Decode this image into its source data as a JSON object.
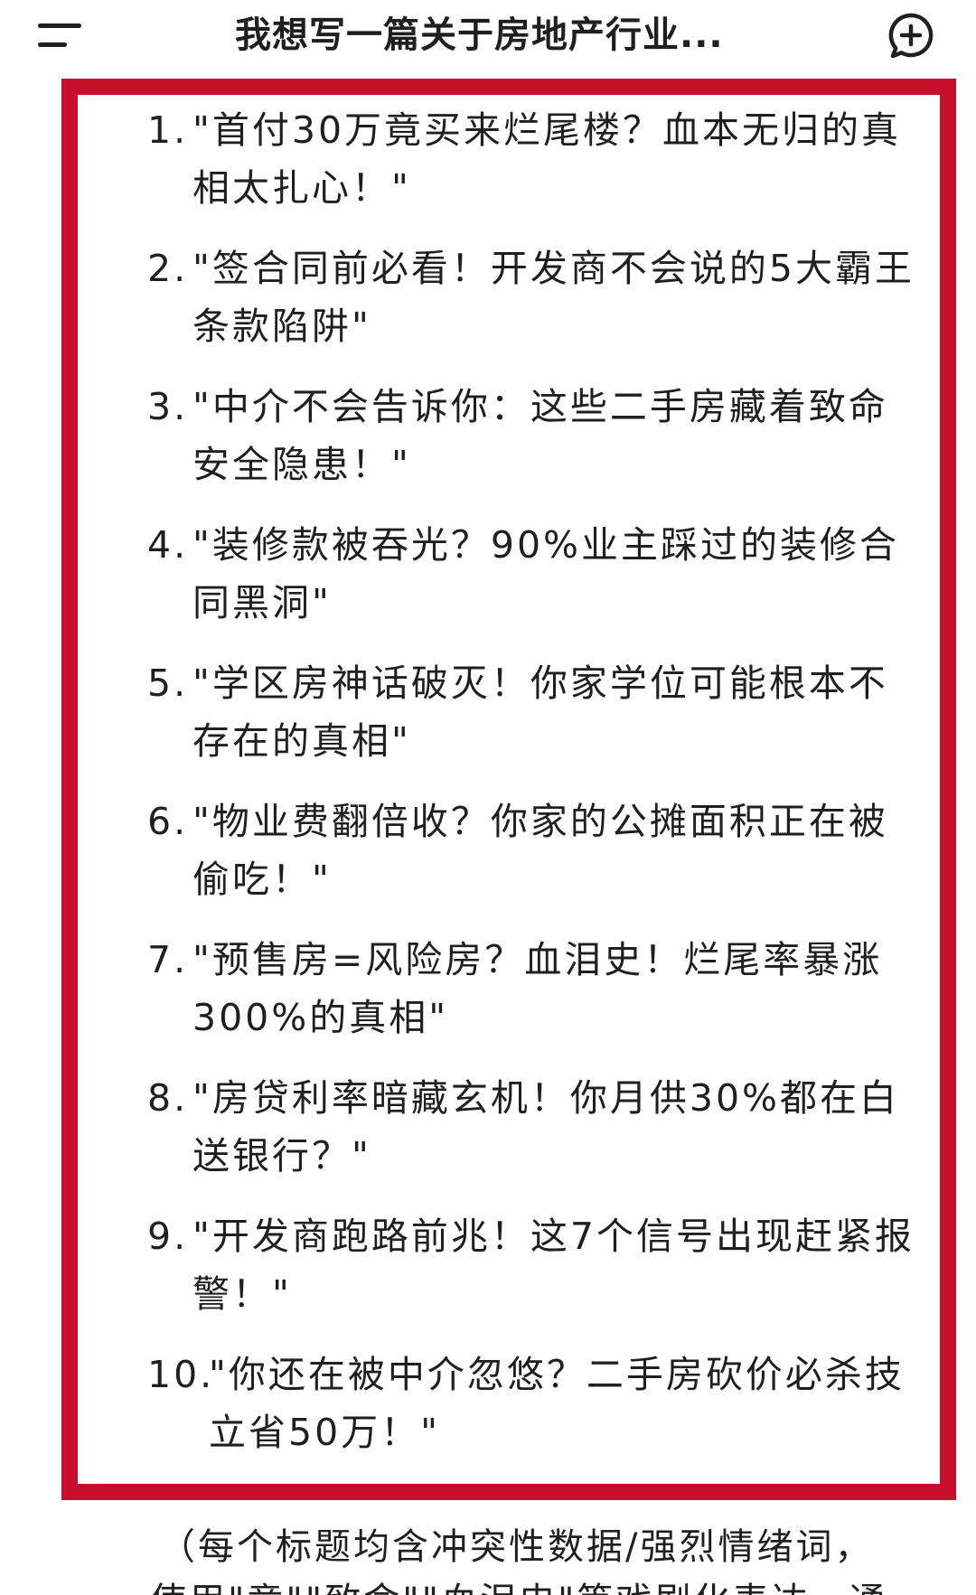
{
  "header": {
    "title": "我想写一篇关于房地产行业...",
    "menu_icon": "menu-icon",
    "new_chat_icon": "add-chat-bubble-icon"
  },
  "colors": {
    "highlight_frame": "#c8102e",
    "text": "#1f1f1f",
    "background": "#ffffff"
  },
  "list": {
    "items": [
      {
        "num": "1.",
        "text": "\"首付30万竟买来烂尾楼？血本无归的真相太扎心！\""
      },
      {
        "num": "2.",
        "text": "\"签合同前必看！开发商不会说的5大霸王条款陷阱\""
      },
      {
        "num": "3.",
        "text": "\"中介不会告诉你：这些二手房藏着致命安全隐患！\""
      },
      {
        "num": "4.",
        "text": "\"装修款被吞光？90%业主踩过的装修合同黑洞\""
      },
      {
        "num": "5.",
        "text": "\"学区房神话破灭！你家学位可能根本不存在的真相\""
      },
      {
        "num": "6.",
        "text": "\"物业费翻倍收？你家的公摊面积正在被偷吃！\""
      },
      {
        "num": "7.",
        "text": "\"预售房=风险房？血泪史！烂尾率暴涨300%的真相\""
      },
      {
        "num": "8.",
        "text": "\"房贷利率暗藏玄机！你月供30%都在白送银行？\""
      },
      {
        "num": "9.",
        "text": "\"开发商跑路前兆！这7个信号出现赶紧报警！\""
      },
      {
        "num": "10.",
        "text": "\"你还在被中介忽悠？二手房砍价必杀技立省50万！\""
      }
    ]
  },
  "note": {
    "line1": "（每个标题均含冲突性数据/强烈情绪词，",
    "line2": "使用\"竟\"\"致命\"\"血泪史\"等戏剧化表达，通"
  }
}
